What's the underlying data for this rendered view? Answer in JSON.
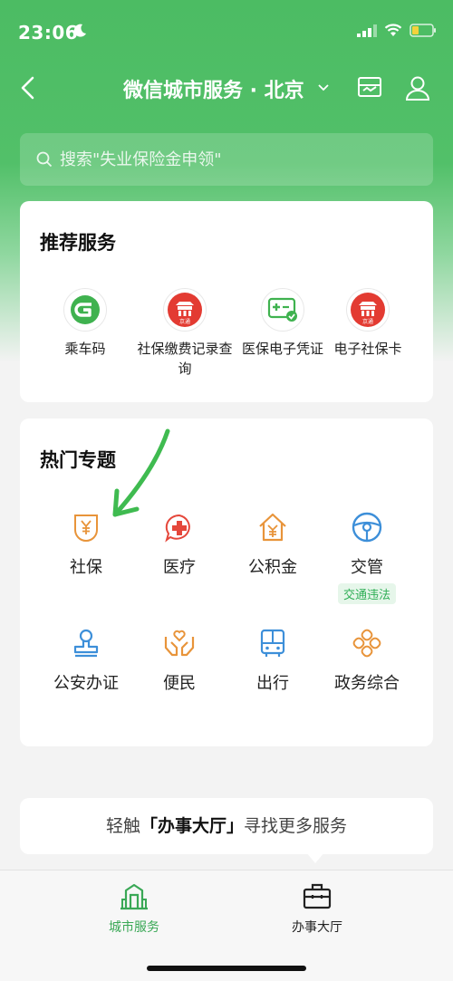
{
  "status": {
    "time": "23:06"
  },
  "nav": {
    "title": "微信城市服务 · 北京"
  },
  "search": {
    "placeholder": "搜索\"失业保险金申领\""
  },
  "recommended": {
    "title": "推荐服务",
    "items": [
      {
        "label": "乘车码",
        "icon": "bus-code-icon"
      },
      {
        "label": "社保缴费记录查询",
        "icon": "beijing-gov-icon",
        "badge": "京通"
      },
      {
        "label": "医保电子凭证",
        "icon": "medical-card-icon"
      },
      {
        "label": "电子社保卡",
        "icon": "beijing-gov-icon",
        "badge": "京通"
      }
    ]
  },
  "hot": {
    "title": "热门专题",
    "items": [
      {
        "label": "社保",
        "icon": "yen-shield-icon"
      },
      {
        "label": "医疗",
        "icon": "medical-cross-icon"
      },
      {
        "label": "公积金",
        "icon": "house-yen-icon"
      },
      {
        "label": "交管",
        "icon": "steering-wheel-icon",
        "tag": "交通违法"
      },
      {
        "label": "公安办证",
        "icon": "stamp-icon"
      },
      {
        "label": "便民",
        "icon": "hands-heart-icon"
      },
      {
        "label": "出行",
        "icon": "bus-icon"
      },
      {
        "label": "政务综合",
        "icon": "clover-icon"
      }
    ]
  },
  "hint": {
    "prefix": "轻触",
    "highlight": "「办事大厅」",
    "suffix": "寻找更多服务"
  },
  "tabs": [
    {
      "label": "城市服务",
      "active": true,
      "icon": "city-buildings-icon"
    },
    {
      "label": "办事大厅",
      "active": false,
      "icon": "briefcase-icon"
    }
  ],
  "colors": {
    "brand_green": "#4cbc63",
    "tag_green": "#2fae56",
    "orange": "#e8943a",
    "red": "#e5473b",
    "blue": "#3d8fd9"
  }
}
